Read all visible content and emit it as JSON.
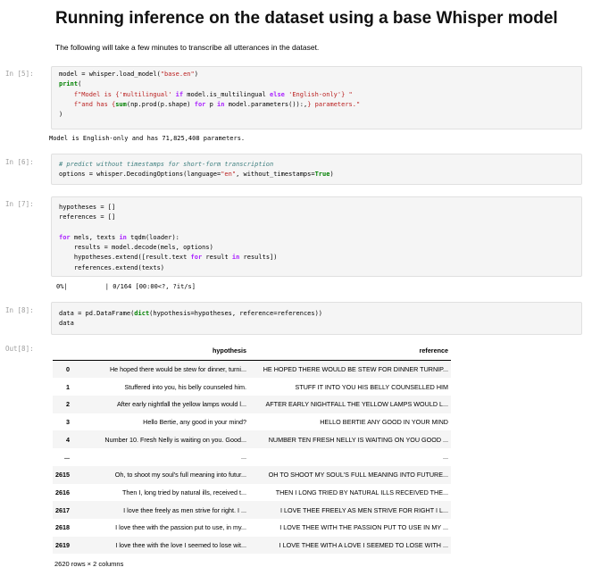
{
  "heading": "Running inference on the dataset using a base Whisper model",
  "subtext": "The following will take a few minutes to transcribe all utterances in the dataset.",
  "prompts": {
    "in5": "In [5]:",
    "in6": "In [6]:",
    "in7": "In [7]:",
    "in8": "In [8]:",
    "out8": "Out[8]:"
  },
  "outputs": {
    "cell5": "Model is English-only and has 71,825,408 parameters.",
    "cell7_progress": "0%|          | 0/164 [00:00<?, ?it/s]"
  },
  "table": {
    "columns": [
      "hypothesis",
      "reference"
    ],
    "rows": [
      {
        "idx": "0",
        "hypothesis": "He hoped there would be stew for dinner, turni...",
        "reference": "HE HOPED THERE WOULD BE STEW FOR DINNER TURNIP..."
      },
      {
        "idx": "1",
        "hypothesis": "Stuffered into you, his belly counseled him.",
        "reference": "STUFF IT INTO YOU HIS BELLY COUNSELLED HIM"
      },
      {
        "idx": "2",
        "hypothesis": "After early nightfall the yellow lamps would l...",
        "reference": "AFTER EARLY NIGHTFALL THE YELLOW LAMPS WOULD L..."
      },
      {
        "idx": "3",
        "hypothesis": "Hello Bertie, any good in your mind?",
        "reference": "HELLO BERTIE ANY GOOD IN YOUR MIND"
      },
      {
        "idx": "4",
        "hypothesis": "Number 10. Fresh Nelly is waiting on you. Good...",
        "reference": "NUMBER TEN FRESH NELLY IS WAITING ON YOU GOOD ..."
      },
      {
        "idx": "...",
        "hypothesis": "...",
        "reference": "..."
      },
      {
        "idx": "2615",
        "hypothesis": "Oh, to shoot my soul's full meaning into futur...",
        "reference": "OH TO SHOOT MY SOUL'S FULL MEANING INTO FUTURE..."
      },
      {
        "idx": "2616",
        "hypothesis": "Then I, long tried by natural ills, received t...",
        "reference": "THEN I LONG TRIED BY NATURAL ILLS RECEIVED THE..."
      },
      {
        "idx": "2617",
        "hypothesis": "I love thee freely as men strive for right. I ...",
        "reference": "I LOVE THEE FREELY AS MEN STRIVE FOR RIGHT I L..."
      },
      {
        "idx": "2618",
        "hypothesis": "I love thee with the passion put to use, in my...",
        "reference": "I LOVE THEE WITH THE PASSION PUT TO USE IN MY ..."
      },
      {
        "idx": "2619",
        "hypothesis": "I love thee with the love I seemed to lose wit...",
        "reference": "I LOVE THEE WITH A LOVE I SEEMED TO LOSE WITH ..."
      }
    ],
    "footer": "2620 rows × 2 columns"
  }
}
